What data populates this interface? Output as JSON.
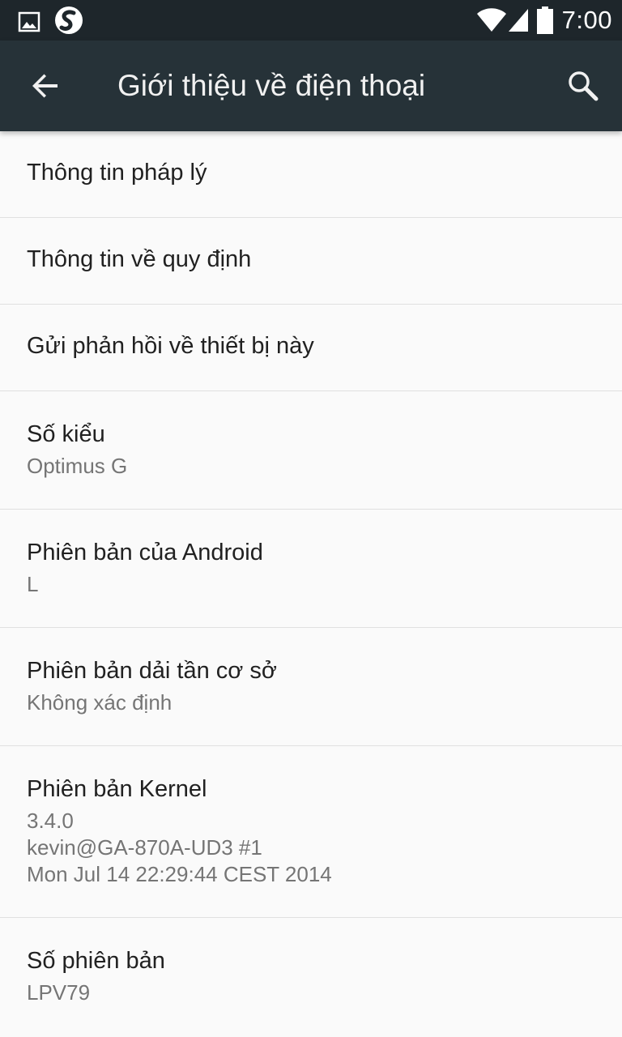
{
  "status_bar": {
    "time": "7:00",
    "left_icons": [
      "image-icon",
      "swype-icon"
    ],
    "right_icons": [
      "wifi-icon",
      "signal-icon",
      "battery-icon"
    ]
  },
  "toolbar": {
    "title": "Giới thiệu về điện thoại",
    "back_icon": "arrow-back-icon",
    "search_icon": "search-icon"
  },
  "items": [
    {
      "title": "Thông tin pháp lý"
    },
    {
      "title": "Thông tin về quy định"
    },
    {
      "title": "Gửi phản hồi về thiết bị này"
    },
    {
      "title": "Số kiểu",
      "summary": "Optimus G"
    },
    {
      "title": "Phiên bản của Android",
      "summary": "L"
    },
    {
      "title": "Phiên bản dải tần cơ sở",
      "summary": "Không xác định"
    },
    {
      "title": "Phiên bản Kernel",
      "summary_lines": [
        "3.4.0",
        "kevin@GA-870A-UD3 #1",
        "Mon Jul 14 22:29:44 CEST 2014"
      ]
    },
    {
      "title": "Số phiên bản",
      "summary": "LPV79"
    }
  ],
  "colors": {
    "toolbar_bg": "#263238",
    "status_bar_bg": "#1e262b",
    "list_bg": "#fafafa",
    "title_text": "#212121",
    "summary_text": "#757575",
    "divider": "#e0e0e0"
  }
}
